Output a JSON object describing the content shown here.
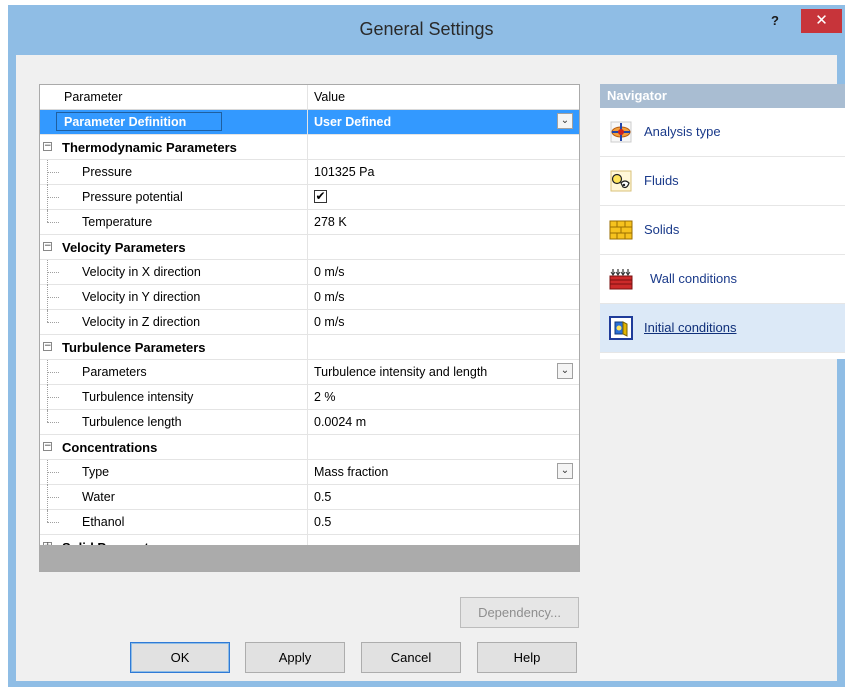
{
  "window": {
    "title": "General Settings",
    "help_glyph": "?",
    "close_glyph": "✕"
  },
  "grid": {
    "headers": {
      "parameter": "Parameter",
      "value": "Value"
    },
    "rows": [
      {
        "kind": "selected",
        "label": "Parameter Definition",
        "value": "User Defined",
        "dropdown": true
      },
      {
        "kind": "category",
        "label": "Thermodynamic Parameters",
        "expanded": true,
        "toggle": "−"
      },
      {
        "kind": "child",
        "label": "Pressure",
        "value": "101325 Pa"
      },
      {
        "kind": "child",
        "label": "Pressure potential",
        "value": "",
        "checkbox": true,
        "checked": "✔"
      },
      {
        "kind": "child",
        "label": "Temperature",
        "value": "278 K",
        "last": true
      },
      {
        "kind": "category",
        "label": "Velocity Parameters",
        "expanded": true,
        "toggle": "−"
      },
      {
        "kind": "child",
        "label": "Velocity in X direction",
        "value": "0 m/s"
      },
      {
        "kind": "child",
        "label": "Velocity in Y direction",
        "value": "0 m/s"
      },
      {
        "kind": "child",
        "label": "Velocity in Z direction",
        "value": "0 m/s",
        "last": true
      },
      {
        "kind": "category",
        "label": "Turbulence Parameters",
        "expanded": true,
        "toggle": "−"
      },
      {
        "kind": "child",
        "label": "Parameters",
        "value": "Turbulence intensity and length",
        "dropdown": true
      },
      {
        "kind": "child",
        "label": "Turbulence intensity",
        "value": "2 %"
      },
      {
        "kind": "child",
        "label": "Turbulence length",
        "value": "0.0024 m",
        "last": true
      },
      {
        "kind": "category",
        "label": "Concentrations",
        "expanded": true,
        "toggle": "−"
      },
      {
        "kind": "child",
        "label": "Type",
        "value": "Mass fraction",
        "dropdown": true
      },
      {
        "kind": "child",
        "label": "Water",
        "value": "0.5"
      },
      {
        "kind": "child",
        "label": "Ethanol",
        "value": "0.5",
        "last": true
      },
      {
        "kind": "category",
        "label": "Solid Parameters",
        "expanded": false,
        "toggle": "+"
      }
    ],
    "dropdown_glyph": "⌄"
  },
  "navigator": {
    "title": "Navigator",
    "items": [
      {
        "label": "Analysis type",
        "icon": "analysis-type-icon",
        "active": false
      },
      {
        "label": "Fluids",
        "icon": "fluids-icon",
        "active": false
      },
      {
        "label": "Solids",
        "icon": "solids-icon",
        "active": false
      },
      {
        "label": "Wall conditions",
        "icon": "wall-conditions-icon",
        "active": false
      },
      {
        "label": "Initial conditions",
        "icon": "initial-conditions-icon",
        "active": true
      }
    ]
  },
  "buttons": {
    "dependency": "Dependency...",
    "ok": "OK",
    "apply": "Apply",
    "cancel": "Cancel",
    "help": "Help"
  }
}
